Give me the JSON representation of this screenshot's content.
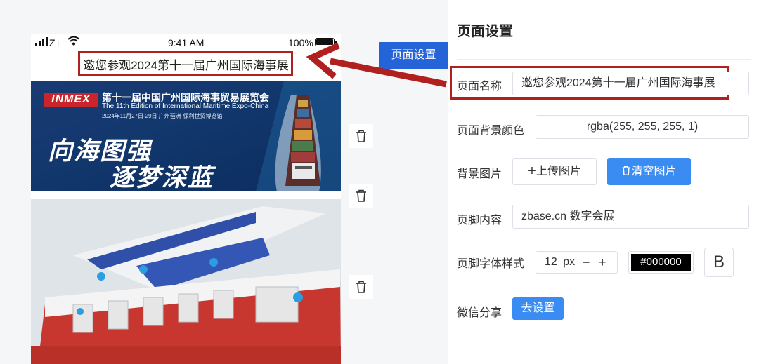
{
  "status_bar": {
    "carrier": "Z+",
    "time": "9:41 AM",
    "battery": "100%"
  },
  "preview": {
    "title": "邀您参观2024第十一届广州国际海事展",
    "banner": {
      "logo": "INMEX",
      "title": "第十一届中国广州国际海事贸易展览会",
      "subtitle": "The 11th Edition of International Maritime Expo-China",
      "date": "2024年11月27日-29日   广州琶洲·保利世贸博览馆",
      "slogan_line1": "向海图强",
      "slogan_line2": "逐梦深蓝"
    }
  },
  "page_settings_button": "页面设置",
  "panel": {
    "heading": "页面设置",
    "page_name": {
      "label": "页面名称",
      "value": "邀您参观2024第十一届广州国际海事展"
    },
    "bg_color": {
      "label": "页面背景颜色",
      "value": "rgba(255, 255, 255, 1)"
    },
    "bg_image": {
      "label": "背景图片",
      "upload": "上传图片",
      "clear": "清空图片"
    },
    "footer": {
      "label": "页脚内容",
      "value": "zbase.cn 数字会展"
    },
    "footer_style": {
      "label": "页脚字体样式",
      "size": "12",
      "unit": "px",
      "minus": "−",
      "plus": "+",
      "color": "#000000",
      "bold": "B"
    },
    "wechat": {
      "label": "微信分享",
      "button": "去设置"
    }
  },
  "colors": {
    "accent": "#3b8cf2",
    "highlight": "#b0201e",
    "primary_button": "#2563d9"
  }
}
